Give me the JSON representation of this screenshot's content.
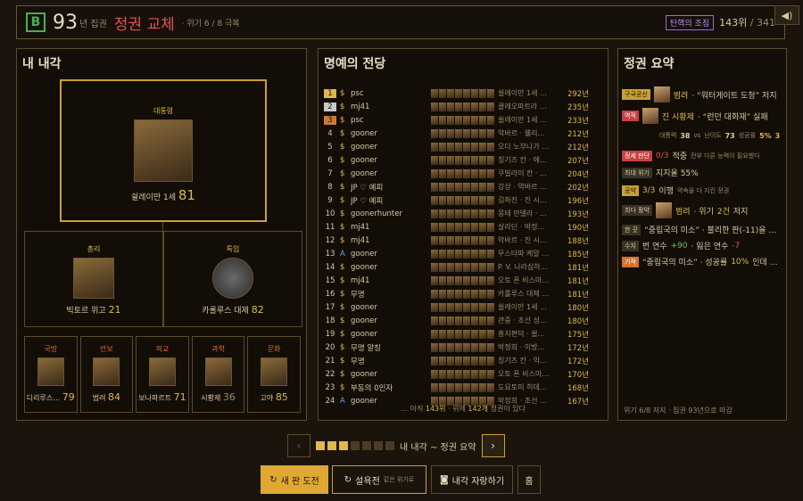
{
  "topbar": {
    "grade": "B",
    "turns": "93",
    "turns_unit": "년 집권",
    "title": "정권 교체",
    "crisis": "· 위기 6 / 8 극복",
    "impeach": "탄핵의 조짐",
    "rank": "143위",
    "rank_total": "/ 341"
  },
  "cabinet": {
    "title": "내 내각",
    "president": {
      "role": "대통령",
      "name": "쉴레이만 1세",
      "score": "81"
    },
    "pm": {
      "role": "총리",
      "name": "빅토르 위고",
      "score": "21"
    },
    "special": {
      "role": "특임",
      "name": "카롤루스 대제",
      "score": "82"
    },
    "ministers": [
      {
        "role": "국방",
        "name": "디리루스…",
        "score": "79"
      },
      {
        "role": "안보",
        "name": "범려",
        "score": "84"
      },
      {
        "role": "외교",
        "name": "보나파르트",
        "score": "71"
      },
      {
        "role": "과학",
        "name": "시황제",
        "score": "36"
      },
      {
        "role": "문화",
        "name": "고야",
        "score": "85"
      }
    ]
  },
  "hall": {
    "title": "명예의 전당",
    "rows": [
      {
        "rank": "1",
        "cur": "$",
        "nick": "psc",
        "cab": "쉴레이만 1세 …",
        "ts": "292년"
      },
      {
        "rank": "2",
        "cur": "$",
        "nick": "mj41",
        "cab": "클레오파트라 …",
        "ts": "235년"
      },
      {
        "rank": "3",
        "cur": "$",
        "nick": "psc",
        "cab": "쉴레이만 1세 …",
        "ts": "233년"
      },
      {
        "rank": "4",
        "cur": "$",
        "nick": "gooner",
        "cab": "악바르 · 웰리…",
        "ts": "212년"
      },
      {
        "rank": "5",
        "cur": "$",
        "nick": "gooner",
        "cab": "오다 노부나가 …",
        "ts": "212년"
      },
      {
        "rank": "6",
        "cur": "$",
        "nick": "gooner",
        "cab": "칭기즈 칸 · 에…",
        "ts": "207년"
      },
      {
        "rank": "7",
        "cur": "$",
        "nick": "gooner",
        "cab": "쿠빌라이 칸 · …",
        "ts": "204년"
      },
      {
        "rank": "8",
        "cur": "$",
        "nick": "JP ♡ 예피",
        "cab": "강상 · 악바르 …",
        "ts": "202년"
      },
      {
        "rank": "9",
        "cur": "$",
        "nick": "JP ♡ 예피",
        "cab": "김좌진 · 진 시…",
        "ts": "196년"
      },
      {
        "rank": "10",
        "cur": "$",
        "nick": "goonerhunter",
        "cab": "몽테 만델라 · …",
        "ts": "193년"
      },
      {
        "rank": "11",
        "cur": "$",
        "nick": "mj41",
        "cab": "살라딘 · 박정…",
        "ts": "190년"
      },
      {
        "rank": "12",
        "cur": "$",
        "nick": "mj41",
        "cab": "악바르 · 진 시…",
        "ts": "188년"
      },
      {
        "rank": "13",
        "cur": "A",
        "nick": "gooner",
        "cab": "무스타파 케말 …",
        "ts": "185년"
      },
      {
        "rank": "14",
        "cur": "$",
        "nick": "gooner",
        "cab": "P. V. 나라심하…",
        "ts": "181년"
      },
      {
        "rank": "15",
        "cur": "$",
        "nick": "mj41",
        "cab": "오토 폰 비스마…",
        "ts": "181년"
      },
      {
        "rank": "16",
        "cur": "$",
        "nick": "무명",
        "cab": "카롤루스 대제 …",
        "ts": "181년"
      },
      {
        "rank": "17",
        "cur": "$",
        "nick": "gooner",
        "cab": "쉴레이만 1세 …",
        "ts": "180년"
      },
      {
        "rank": "18",
        "cur": "$",
        "nick": "gooner",
        "cab": "관중 · 조선 성…",
        "ts": "180년"
      },
      {
        "rank": "19",
        "cur": "$",
        "nick": "gooner",
        "cab": "흥지편덕 · 쉴…",
        "ts": "175년"
      },
      {
        "rank": "20",
        "cur": "$",
        "nick": "무명 알칭",
        "cab": "박정희 · 이방…",
        "ts": "172년"
      },
      {
        "rank": "21",
        "cur": "$",
        "nick": "무명",
        "cab": "칭기즈 칸 · 악…",
        "ts": "172년"
      },
      {
        "rank": "22",
        "cur": "$",
        "nick": "gooner",
        "cab": "오토 폰 비스마…",
        "ts": "170년"
      },
      {
        "rank": "23",
        "cur": "$",
        "nick": "부동의 0인자",
        "cab": "도요토미 히데…",
        "ts": "168년"
      },
      {
        "rank": "24",
        "cur": "A",
        "nick": "gooner",
        "cab": "박정희 · 조선 …",
        "ts": "167년"
      }
    ],
    "footer_a": "… 아직",
    "footer_b": "143위",
    "footer_c": "· 위에",
    "footer_d": "142개",
    "footer_e": "정권이 있다"
  },
  "summary": {
    "title": "정권 요약",
    "l1_tag": "구국공신",
    "l1_name": "범려",
    "l1_text": "· “워터게이트 도청” 저지",
    "l2_tag": "역적",
    "l2_name": "진 시황제",
    "l2_text": "· “런던 대화재” 실패",
    "l3": "대통력",
    "l3_v": "38",
    "l3_vs": "vs",
    "l3_b": "난이도",
    "l3_bv": "73",
    "l3_c": "성공률",
    "l3_cv": "5%",
    "l3_d": "3",
    "l4_tag": "정세 판단",
    "l4_v": "0/3",
    "l4_t": "적중",
    "l4_s": "전부 다른 능력이 필요했다",
    "l5_tag": "최대 위기",
    "l5_t": "지지율 55%",
    "l6_tag": "공약",
    "l6_v": "3/3",
    "l6_t": "이행",
    "l6_s": "약속을 다 지킨 정권",
    "l7_tag": "최다 활약",
    "l7_name": "범려",
    "l7_t": "· 위기",
    "l7_v": "2건",
    "l7_t2": "저지",
    "l8_tag": "한 끗",
    "l8_t": "“중립국의 미소” · 불리한 판(-11)을 …",
    "l9_tag": "수지",
    "l9_a": "번 연수",
    "l9_av": "+90",
    "l9_b": "· 잃은 연수",
    "l9_bv": "-7",
    "l10_tag": "기적",
    "l10_t": "“중립국의 미소” · 성공률",
    "l10_v": "10%",
    "l10_t2": "인데 …",
    "footer": "위기 6/8 저지 · 집권 93년으로 마감"
  },
  "pager": {
    "label": "내 내각 ~ 정권 요약",
    "prev": "‹",
    "next": "›"
  },
  "buttons": {
    "new": "새 판 도전",
    "same": "설욕전",
    "same_sub": "같은 위기로",
    "share": "내각 자랑하기",
    "home": "홈"
  }
}
